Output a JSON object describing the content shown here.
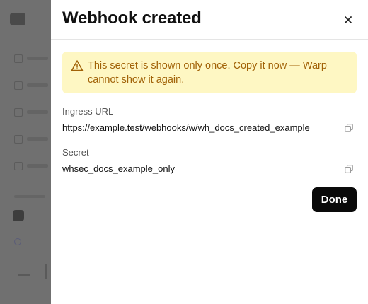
{
  "dialog": {
    "title": "Webhook created",
    "warning": "This secret is shown only once. Copy it now — Warp cannot show it again.",
    "fields": [
      {
        "label": "Ingress URL",
        "value": "https://example.test/webhooks/w/wh_docs_created_example"
      },
      {
        "label": "Secret",
        "value": "whsec_docs_example_only"
      }
    ],
    "done_label": "Done"
  },
  "icons": {
    "close": "close-icon",
    "warning": "warning-triangle-icon",
    "copy": "copy-icon"
  },
  "colors": {
    "alert_bg": "#fef7c3",
    "alert_text": "#a16207",
    "primary_button": "#0a0a0a",
    "overlay": "#707070"
  }
}
